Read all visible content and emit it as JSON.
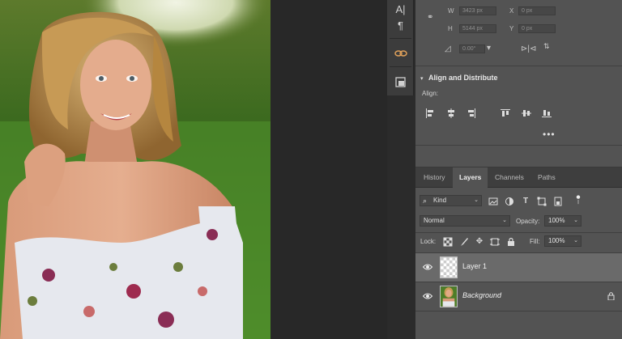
{
  "transform": {
    "w_label": "W",
    "w_value": "3423 px",
    "x_label": "X",
    "x_value": "0 px",
    "h_label": "H",
    "h_value": "5144 px",
    "y_label": "Y",
    "y_value": "0 px",
    "angle_value": "0.00°"
  },
  "align": {
    "title": "Align and Distribute",
    "subtitle": "Align:",
    "more": "•••"
  },
  "layers_panel": {
    "tabs": [
      "History",
      "Layers",
      "Channels",
      "Paths"
    ],
    "active_tab": "Layers",
    "filter_kind": "Kind",
    "blend_mode": "Normal",
    "opacity_label": "Opacity:",
    "opacity_value": "100%",
    "lock_label": "Lock:",
    "fill_label": "Fill:",
    "fill_value": "100%",
    "layers": [
      {
        "name": "Layer 1",
        "selected": true,
        "visible": true,
        "transparent": true
      },
      {
        "name": "Background",
        "selected": false,
        "visible": true,
        "locked": true
      }
    ]
  },
  "tool_strip": {
    "icons": [
      "character-icon",
      "paragraph-icon",
      "link-icon",
      "navigator-icon"
    ]
  },
  "colors": {
    "panel_bg": "#535353",
    "tab_bar_bg": "#3e3e3e",
    "selected_layer_bg": "#6a6a6a",
    "pasteboard": "#282828"
  }
}
